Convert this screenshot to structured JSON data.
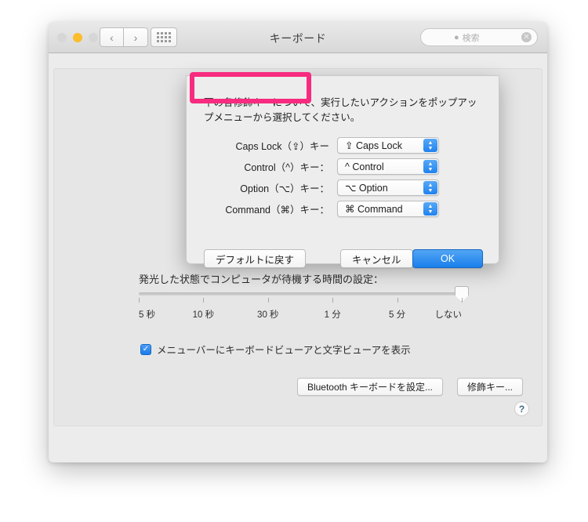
{
  "window": {
    "title": "キーボード",
    "traffic_lights": [
      "close",
      "minimize",
      "zoom"
    ],
    "nav_back": "‹",
    "nav_forward": "›",
    "grid_icon": "grid-icon"
  },
  "search": {
    "placeholder": "検索",
    "icon": "search-icon",
    "clear": "✕"
  },
  "panel": {
    "ghost_text": "",
    "slider_label": "発光した状態でコンピュータが待機する時間の設定：",
    "slider": {
      "ticks": [
        "5 秒",
        "10 秒",
        "30 秒",
        "1 分",
        "5 分",
        "しない"
      ],
      "value": "しない",
      "value_index": 5
    },
    "checkbox": {
      "checked": true,
      "mark": "✓",
      "label": "メニューバーにキーボードビューアと文字ビューアを表示"
    },
    "buttons": [
      {
        "label": "Bluetooth キーボードを設定..."
      },
      {
        "label": "修飾キー..."
      }
    ],
    "help_label": "?"
  },
  "sheet": {
    "intro": "下の各修飾キーについて、実行したいアクションをポップアップメニューから選択してください。",
    "rows": [
      {
        "label": "Caps Lock（⇪）キー",
        "value": "⇪ Caps Lock",
        "highlighted": true
      },
      {
        "label": "Control（^）キー：",
        "value": "^ Control",
        "highlighted": false
      },
      {
        "label": "Option（⌥）キー：",
        "value": "⌥ Option",
        "highlighted": false
      },
      {
        "label": "Command（⌘）キー：",
        "value": "⌘ Command",
        "highlighted": false
      }
    ],
    "stepper_up": "▲",
    "stepper_down": "▼",
    "buttons": {
      "restore_defaults": "デフォルトに戻す",
      "cancel": "キャンセル",
      "ok": "OK"
    }
  },
  "colors": {
    "accent_blue": "#1a7fec",
    "annotation_pink": "#f72b7f",
    "window_bg": "#ececec",
    "panel_bg": "#e6e6e6"
  }
}
